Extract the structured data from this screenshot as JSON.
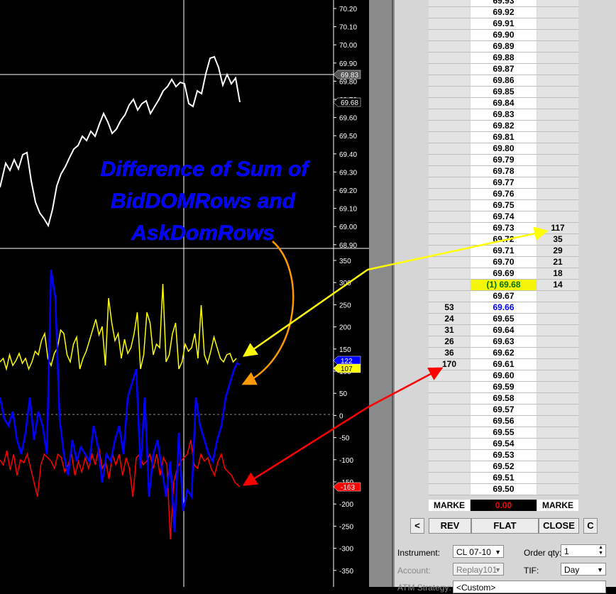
{
  "chart": {
    "price_axis_labels": [
      "70.20",
      "70.10",
      "70.00",
      "69.90",
      "69.80",
      "69.70",
      "69.60",
      "69.50",
      "69.40",
      "69.30",
      "69.20",
      "69.10",
      "69.00",
      "68.90"
    ],
    "price_markers": {
      "cursor": "69.83",
      "last": "69.68"
    },
    "indicator_axis_labels": [
      "350",
      "300",
      "250",
      "200",
      "150",
      "100",
      "50",
      "0",
      "-50",
      "-100",
      "-150",
      "-200",
      "-250",
      "-300",
      "-350"
    ],
    "indicator_markers": {
      "blue": "122",
      "yellow": "107",
      "red": "-163"
    },
    "annotation_lines": [
      "Difference of Sum of",
      "BidDOMRows and",
      "AskDomRows"
    ],
    "colors": {
      "price_line": "#ffffff",
      "blue_series": "#0000ff",
      "yellow_series": "#ffff00",
      "red_series": "#ff0000",
      "annotation": "#0000ff",
      "arrow_orange": "#ff9900",
      "arrow_yellow": "#ffff00",
      "arrow_red": "#ff0000"
    }
  },
  "dom": {
    "rows": [
      {
        "price": "69.93",
        "bid": "",
        "ask": ""
      },
      {
        "price": "69.92",
        "bid": "",
        "ask": ""
      },
      {
        "price": "69.91",
        "bid": "",
        "ask": ""
      },
      {
        "price": "69.90",
        "bid": "",
        "ask": ""
      },
      {
        "price": "69.89",
        "bid": "",
        "ask": ""
      },
      {
        "price": "69.88",
        "bid": "",
        "ask": ""
      },
      {
        "price": "69.87",
        "bid": "",
        "ask": ""
      },
      {
        "price": "69.86",
        "bid": "",
        "ask": ""
      },
      {
        "price": "69.85",
        "bid": "",
        "ask": ""
      },
      {
        "price": "69.84",
        "bid": "",
        "ask": ""
      },
      {
        "price": "69.83",
        "bid": "",
        "ask": ""
      },
      {
        "price": "69.82",
        "bid": "",
        "ask": ""
      },
      {
        "price": "69.81",
        "bid": "",
        "ask": ""
      },
      {
        "price": "69.80",
        "bid": "",
        "ask": ""
      },
      {
        "price": "69.79",
        "bid": "",
        "ask": ""
      },
      {
        "price": "69.78",
        "bid": "",
        "ask": ""
      },
      {
        "price": "69.77",
        "bid": "",
        "ask": ""
      },
      {
        "price": "69.76",
        "bid": "",
        "ask": ""
      },
      {
        "price": "69.75",
        "bid": "",
        "ask": ""
      },
      {
        "price": "69.74",
        "bid": "",
        "ask": ""
      },
      {
        "price": "69.73",
        "bid": "",
        "ask": "117"
      },
      {
        "price": "69.72",
        "bid": "",
        "ask": "35"
      },
      {
        "price": "69.71",
        "bid": "",
        "ask": "29"
      },
      {
        "price": "69.70",
        "bid": "",
        "ask": "21"
      },
      {
        "price": "69.69",
        "bid": "",
        "ask": "18"
      },
      {
        "price": "(1) 69.68",
        "bid": "",
        "ask": "14",
        "style": "last"
      },
      {
        "price": "69.67",
        "bid": "",
        "ask": ""
      },
      {
        "price": "69.66",
        "bid": "53",
        "ask": "",
        "style": "blue"
      },
      {
        "price": "69.65",
        "bid": "24",
        "ask": ""
      },
      {
        "price": "69.64",
        "bid": "31",
        "ask": ""
      },
      {
        "price": "69.63",
        "bid": "26",
        "ask": ""
      },
      {
        "price": "69.62",
        "bid": "36",
        "ask": ""
      },
      {
        "price": "69.61",
        "bid": "170",
        "ask": ""
      },
      {
        "price": "69.60",
        "bid": "",
        "ask": ""
      },
      {
        "price": "69.59",
        "bid": "",
        "ask": ""
      },
      {
        "price": "69.58",
        "bid": "",
        "ask": ""
      },
      {
        "price": "69.57",
        "bid": "",
        "ask": ""
      },
      {
        "price": "69.56",
        "bid": "",
        "ask": ""
      },
      {
        "price": "69.55",
        "bid": "",
        "ask": ""
      },
      {
        "price": "69.54",
        "bid": "",
        "ask": ""
      },
      {
        "price": "69.53",
        "bid": "",
        "ask": ""
      },
      {
        "price": "69.52",
        "bid": "",
        "ask": ""
      },
      {
        "price": "69.51",
        "bid": "",
        "ask": ""
      },
      {
        "price": "69.50",
        "bid": "",
        "ask": ""
      }
    ],
    "market_bid_label": "MARKE",
    "pnl": "0.00",
    "market_ask_label": "MARKE",
    "buttons": {
      "left_arrow": "<",
      "rev": "REV",
      "flat": "FLAT",
      "close": "CLOSE",
      "c": "C"
    },
    "form": {
      "instrument_label": "Instrument:",
      "instrument_value": "CL 07-10",
      "order_qty_label": "Order qty:",
      "order_qty_value": "1",
      "account_label": "Account:",
      "account_value": "Replay101",
      "tif_label": "TIF:",
      "tif_value": "Day",
      "atm_label": "ATM Strategy:",
      "atm_value": "<Custom>"
    }
  }
}
